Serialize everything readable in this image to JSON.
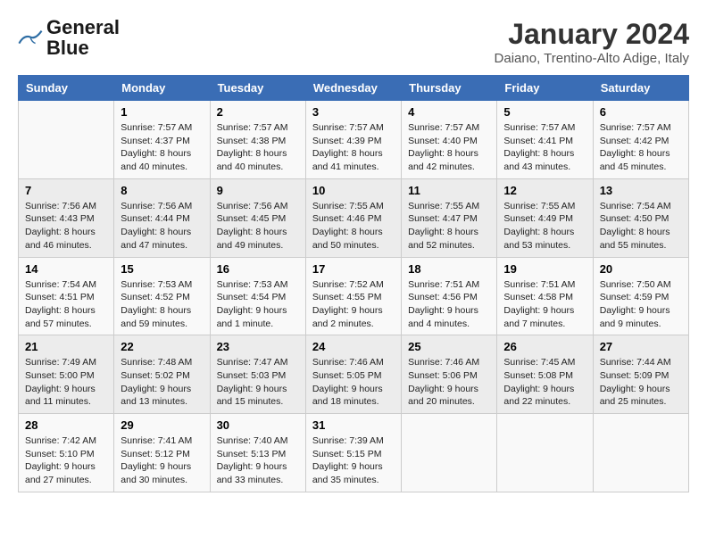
{
  "header": {
    "logo_line1": "General",
    "logo_line2": "Blue",
    "month_title": "January 2024",
    "subtitle": "Daiano, Trentino-Alto Adige, Italy"
  },
  "days_of_week": [
    "Sunday",
    "Monday",
    "Tuesday",
    "Wednesday",
    "Thursday",
    "Friday",
    "Saturday"
  ],
  "weeks": [
    [
      {
        "day": "",
        "info": ""
      },
      {
        "day": "1",
        "info": "Sunrise: 7:57 AM\nSunset: 4:37 PM\nDaylight: 8 hours\nand 40 minutes."
      },
      {
        "day": "2",
        "info": "Sunrise: 7:57 AM\nSunset: 4:38 PM\nDaylight: 8 hours\nand 40 minutes."
      },
      {
        "day": "3",
        "info": "Sunrise: 7:57 AM\nSunset: 4:39 PM\nDaylight: 8 hours\nand 41 minutes."
      },
      {
        "day": "4",
        "info": "Sunrise: 7:57 AM\nSunset: 4:40 PM\nDaylight: 8 hours\nand 42 minutes."
      },
      {
        "day": "5",
        "info": "Sunrise: 7:57 AM\nSunset: 4:41 PM\nDaylight: 8 hours\nand 43 minutes."
      },
      {
        "day": "6",
        "info": "Sunrise: 7:57 AM\nSunset: 4:42 PM\nDaylight: 8 hours\nand 45 minutes."
      }
    ],
    [
      {
        "day": "7",
        "info": "Sunrise: 7:56 AM\nSunset: 4:43 PM\nDaylight: 8 hours\nand 46 minutes."
      },
      {
        "day": "8",
        "info": "Sunrise: 7:56 AM\nSunset: 4:44 PM\nDaylight: 8 hours\nand 47 minutes."
      },
      {
        "day": "9",
        "info": "Sunrise: 7:56 AM\nSunset: 4:45 PM\nDaylight: 8 hours\nand 49 minutes."
      },
      {
        "day": "10",
        "info": "Sunrise: 7:55 AM\nSunset: 4:46 PM\nDaylight: 8 hours\nand 50 minutes."
      },
      {
        "day": "11",
        "info": "Sunrise: 7:55 AM\nSunset: 4:47 PM\nDaylight: 8 hours\nand 52 minutes."
      },
      {
        "day": "12",
        "info": "Sunrise: 7:55 AM\nSunset: 4:49 PM\nDaylight: 8 hours\nand 53 minutes."
      },
      {
        "day": "13",
        "info": "Sunrise: 7:54 AM\nSunset: 4:50 PM\nDaylight: 8 hours\nand 55 minutes."
      }
    ],
    [
      {
        "day": "14",
        "info": "Sunrise: 7:54 AM\nSunset: 4:51 PM\nDaylight: 8 hours\nand 57 minutes."
      },
      {
        "day": "15",
        "info": "Sunrise: 7:53 AM\nSunset: 4:52 PM\nDaylight: 8 hours\nand 59 minutes."
      },
      {
        "day": "16",
        "info": "Sunrise: 7:53 AM\nSunset: 4:54 PM\nDaylight: 9 hours\nand 1 minute."
      },
      {
        "day": "17",
        "info": "Sunrise: 7:52 AM\nSunset: 4:55 PM\nDaylight: 9 hours\nand 2 minutes."
      },
      {
        "day": "18",
        "info": "Sunrise: 7:51 AM\nSunset: 4:56 PM\nDaylight: 9 hours\nand 4 minutes."
      },
      {
        "day": "19",
        "info": "Sunrise: 7:51 AM\nSunset: 4:58 PM\nDaylight: 9 hours\nand 7 minutes."
      },
      {
        "day": "20",
        "info": "Sunrise: 7:50 AM\nSunset: 4:59 PM\nDaylight: 9 hours\nand 9 minutes."
      }
    ],
    [
      {
        "day": "21",
        "info": "Sunrise: 7:49 AM\nSunset: 5:00 PM\nDaylight: 9 hours\nand 11 minutes."
      },
      {
        "day": "22",
        "info": "Sunrise: 7:48 AM\nSunset: 5:02 PM\nDaylight: 9 hours\nand 13 minutes."
      },
      {
        "day": "23",
        "info": "Sunrise: 7:47 AM\nSunset: 5:03 PM\nDaylight: 9 hours\nand 15 minutes."
      },
      {
        "day": "24",
        "info": "Sunrise: 7:46 AM\nSunset: 5:05 PM\nDaylight: 9 hours\nand 18 minutes."
      },
      {
        "day": "25",
        "info": "Sunrise: 7:46 AM\nSunset: 5:06 PM\nDaylight: 9 hours\nand 20 minutes."
      },
      {
        "day": "26",
        "info": "Sunrise: 7:45 AM\nSunset: 5:08 PM\nDaylight: 9 hours\nand 22 minutes."
      },
      {
        "day": "27",
        "info": "Sunrise: 7:44 AM\nSunset: 5:09 PM\nDaylight: 9 hours\nand 25 minutes."
      }
    ],
    [
      {
        "day": "28",
        "info": "Sunrise: 7:42 AM\nSunset: 5:10 PM\nDaylight: 9 hours\nand 27 minutes."
      },
      {
        "day": "29",
        "info": "Sunrise: 7:41 AM\nSunset: 5:12 PM\nDaylight: 9 hours\nand 30 minutes."
      },
      {
        "day": "30",
        "info": "Sunrise: 7:40 AM\nSunset: 5:13 PM\nDaylight: 9 hours\nand 33 minutes."
      },
      {
        "day": "31",
        "info": "Sunrise: 7:39 AM\nSunset: 5:15 PM\nDaylight: 9 hours\nand 35 minutes."
      },
      {
        "day": "",
        "info": ""
      },
      {
        "day": "",
        "info": ""
      },
      {
        "day": "",
        "info": ""
      }
    ]
  ]
}
